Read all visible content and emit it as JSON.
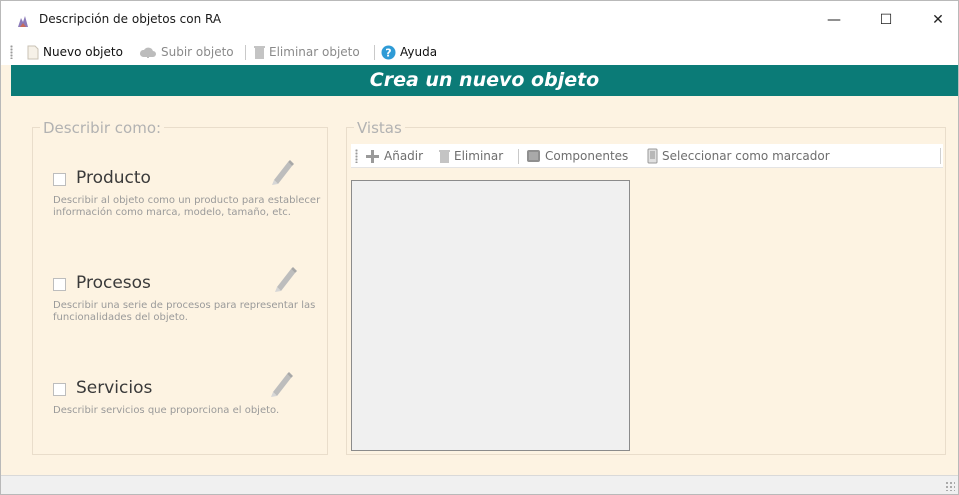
{
  "window": {
    "title": "Descripción de objetos con RA",
    "minimize_label": "—",
    "maximize_label": "☐",
    "close_label": "✕"
  },
  "toolbar": {
    "new_object": "Nuevo objeto",
    "upload_object": "Subir objeto",
    "delete_object": "Eliminar objeto",
    "help": "Ayuda"
  },
  "banner": {
    "title": "Crea un nuevo objeto"
  },
  "describe_group": {
    "legend": "Describir como:",
    "options": [
      {
        "label": "Producto",
        "description": "Describir al objeto como un producto para establecer información como marca, modelo, tamaño, etc.",
        "checked": false
      },
      {
        "label": "Procesos",
        "description": "Describir una serie de procesos para representar las funcionalidades del objeto.",
        "checked": false
      },
      {
        "label": "Servicios",
        "description": "Describir servicios que proporciona el objeto.",
        "checked": false
      }
    ]
  },
  "views_group": {
    "legend": "Vistas",
    "toolbar": {
      "add": "Añadir",
      "delete": "Eliminar",
      "components": "Componentes",
      "set_marker": "Seleccionar como marcador"
    }
  },
  "colors": {
    "banner_bg": "#0b7b77",
    "window_bg": "#fdf3e2",
    "help_icon": "#2e9bd6"
  }
}
